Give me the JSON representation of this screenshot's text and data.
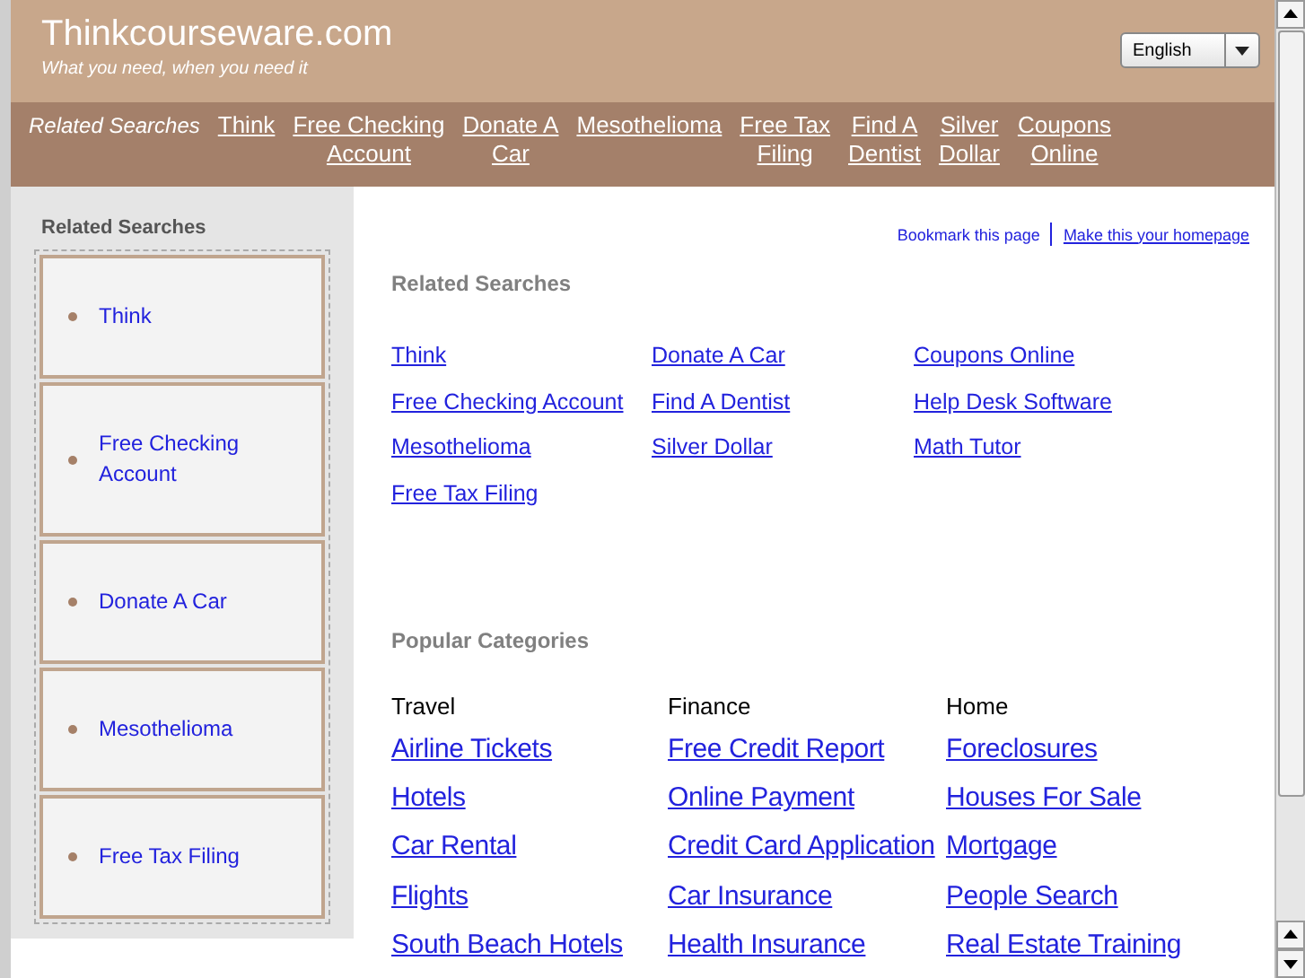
{
  "header": {
    "site_title": "Thinkcourseware.com",
    "tagline": "What you need, when you need it",
    "language_select": {
      "value": "English"
    }
  },
  "nav": {
    "label": "Related Searches",
    "links": [
      {
        "lines": [
          "Think"
        ]
      },
      {
        "lines": [
          "Free Checking",
          "Account"
        ]
      },
      {
        "lines": [
          "Donate A",
          "Car"
        ]
      },
      {
        "lines": [
          "Mesothelioma"
        ]
      },
      {
        "lines": [
          "Free Tax",
          "Filing"
        ]
      },
      {
        "lines": [
          "Find A",
          "Dentist"
        ]
      },
      {
        "lines": [
          "Silver",
          "Dollar"
        ]
      },
      {
        "lines": [
          "Coupons",
          "Online"
        ]
      }
    ]
  },
  "sidebar": {
    "title": "Related Searches",
    "items": [
      {
        "label": "Think"
      },
      {
        "label": "Free Checking Account"
      },
      {
        "label": "Donate A Car"
      },
      {
        "label": "Mesothelioma"
      },
      {
        "label": "Free Tax Filing"
      }
    ]
  },
  "top_links": [
    "Bookmark this page",
    "Make this your homepage"
  ],
  "related_searches": {
    "title": "Related Searches",
    "columns": [
      [
        "Think",
        "Free Checking Account",
        "Mesothelioma",
        "Free Tax Filing"
      ],
      [
        "Donate A Car",
        "Find A Dentist",
        "Silver Dollar"
      ],
      [
        "Coupons Online",
        "Help Desk Software",
        "Math Tutor"
      ]
    ]
  },
  "popular_categories": {
    "title": "Popular Categories",
    "columns": [
      {
        "heading": "Travel",
        "links": [
          "Airline Tickets",
          "Hotels",
          "Car Rental",
          "Flights",
          "South Beach Hotels"
        ]
      },
      {
        "heading": "Finance",
        "links": [
          "Free Credit Report",
          "Online Payment",
          "Credit Card Application",
          "Car Insurance",
          "Health Insurance"
        ]
      },
      {
        "heading": "Home",
        "links": [
          "Foreclosures",
          "Houses For Sale",
          "Mortgage",
          "People Search",
          "Real Estate Training"
        ]
      }
    ]
  }
}
